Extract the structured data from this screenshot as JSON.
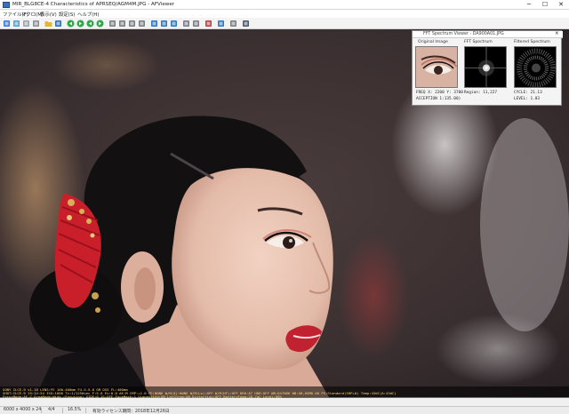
{
  "window": {
    "title": "MIR_BLG8CE-4 Characteristics of APRSEQ/AGM4M.JPG - AFViewer",
    "minimize_glyph": "─",
    "maximize_glyph": "☐",
    "close_glyph": "✕"
  },
  "menu": [
    "ファイル(F)",
    "マクロ(M)",
    "表示(V)",
    "設定(S)",
    "ヘルプ(H)"
  ],
  "toolbar": {
    "buttons": [
      {
        "icon": "image-icon",
        "color": "#3d7ad6"
      },
      {
        "icon": "monitor-icon",
        "color": "#4aa3d8"
      },
      {
        "icon": "copy-icon",
        "color": "#9aa3ad"
      },
      {
        "icon": "grid-icon",
        "color": "#8a9098"
      },
      {
        "icon": "folder-icon",
        "color": "#e6b43c"
      },
      {
        "icon": "save-icon",
        "color": "#2f6fb7"
      },
      {
        "icon": "back-icon",
        "color": "#2fa84a"
      },
      {
        "icon": "forward-icon",
        "color": "#2fa84a"
      },
      {
        "icon": "first-icon",
        "color": "#2fa84a"
      },
      {
        "icon": "last-icon",
        "color": "#2fa84a"
      },
      {
        "icon": "fit-icon",
        "color": "#7a7f86"
      },
      {
        "icon": "zoom-in-icon",
        "color": "#7a7f86"
      },
      {
        "icon": "zoom-out-icon",
        "color": "#7a7f86"
      },
      {
        "icon": "zoom-actual-icon",
        "color": "#7a7f86"
      },
      {
        "icon": "rotate-left-icon",
        "color": "#2f79c9"
      },
      {
        "icon": "rotate-right-icon",
        "color": "#2f79c9"
      },
      {
        "icon": "flip-icon",
        "color": "#2f79c9"
      },
      {
        "icon": "crop-icon",
        "color": "#7a7f86"
      },
      {
        "icon": "print-icon",
        "color": "#7a7f86"
      },
      {
        "icon": "info-icon",
        "color": "#c63b3b"
      },
      {
        "icon": "spectrum-icon",
        "color": "#2f79c9"
      },
      {
        "icon": "settings-icon",
        "color": "#7a7f86"
      },
      {
        "icon": "help-icon",
        "color": "#4a5a6a"
      }
    ]
  },
  "spectrum_viewer": {
    "title": "FFT Spectrum Viewer - DA900A01.JPG",
    "close_glyph": "✕",
    "labels": [
      "Original Image",
      "FFT Spectrum",
      "Filtered Spectrum"
    ],
    "info": {
      "left_line1": "FREQ X: 2200  Y: 3700",
      "left_line2": "ACCEPTION  1:135.00)",
      "mid_line1": "Region:      11,227",
      "right_line1": "CYCLE:        21.13",
      "right_line2": "LEVEL:         1.03"
    }
  },
  "exif_overlay": {
    "line1": "SONY ILCE-9 v1.10  LENS:FE 100-400mm F4.5-5.6 GM OSS  FL:400mm",
    "line2": "SHOT:ILCE-9 15:14:54  ISO:1000  Tv:1/1250sec  F:5.6  Ev:0.0   AE:M  CMP:+1.0  FE:NONE  W/M(0):NONE  W/M(Lo):OFF  W/M(HF):OFF  DRO:AT  HDR:OFF  WB:D4700K  WB:AB,0GM0.00  PS:Standard(SHP+0)  Temp:43dC(A:43dC)",
    "line3": "FocusMode:AF-C  AreaMode:Wide  (Focusing)  SIDE:0  IS:OFF  FaceMach:1  Vignetting:ON  LatChrom:ON  Distortion:OFF  BatteryTemp:28.7dC  Level:98%"
  },
  "status": {
    "dimensions": "6000 x 4000 x 24",
    "index": "4/4",
    "zoom": "16.5%",
    "license": "有効ライセンス期間：2018年12月26日"
  }
}
